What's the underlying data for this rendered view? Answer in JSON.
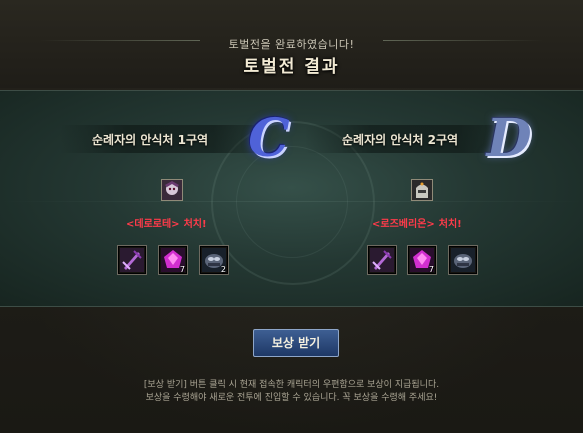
{
  "header": {
    "subtitle": "토벌전을 완료하였습니다!",
    "title": "토벌전 결과"
  },
  "zones": [
    {
      "name": "순례자의 안식처 1구역",
      "grade": "C",
      "boss_name": "<데로로테>",
      "kill_label": "처치!",
      "rewards": [
        {
          "icon": "purple-weapon-icon",
          "qty": ""
        },
        {
          "icon": "purple-gem-icon",
          "qty": "7"
        },
        {
          "icon": "dark-bundle-icon",
          "qty": "2"
        }
      ]
    },
    {
      "name": "순례자의 안식처 2구역",
      "grade": "D",
      "boss_name": "<로즈베리온>",
      "kill_label": "처치!",
      "rewards": [
        {
          "icon": "purple-weapon-icon",
          "qty": ""
        },
        {
          "icon": "purple-gem-icon",
          "qty": "7"
        },
        {
          "icon": "dark-bundle-icon",
          "qty": ""
        }
      ]
    }
  ],
  "claim_button": "보상 받기",
  "notice": {
    "line1": "[보상 받기] 버튼 클릭 시 현재 접속한 캐릭터의 우편함으로 보상이 지급됩니다.",
    "line2": "보상을 수령해야 새로운 전투에 진입할 수 있습니다. 꼭 보상을 수령해 주세요!"
  },
  "colors": {
    "kill_text": "#ff3b4a",
    "button": "#2c4a7c",
    "board": "#2a403a"
  }
}
